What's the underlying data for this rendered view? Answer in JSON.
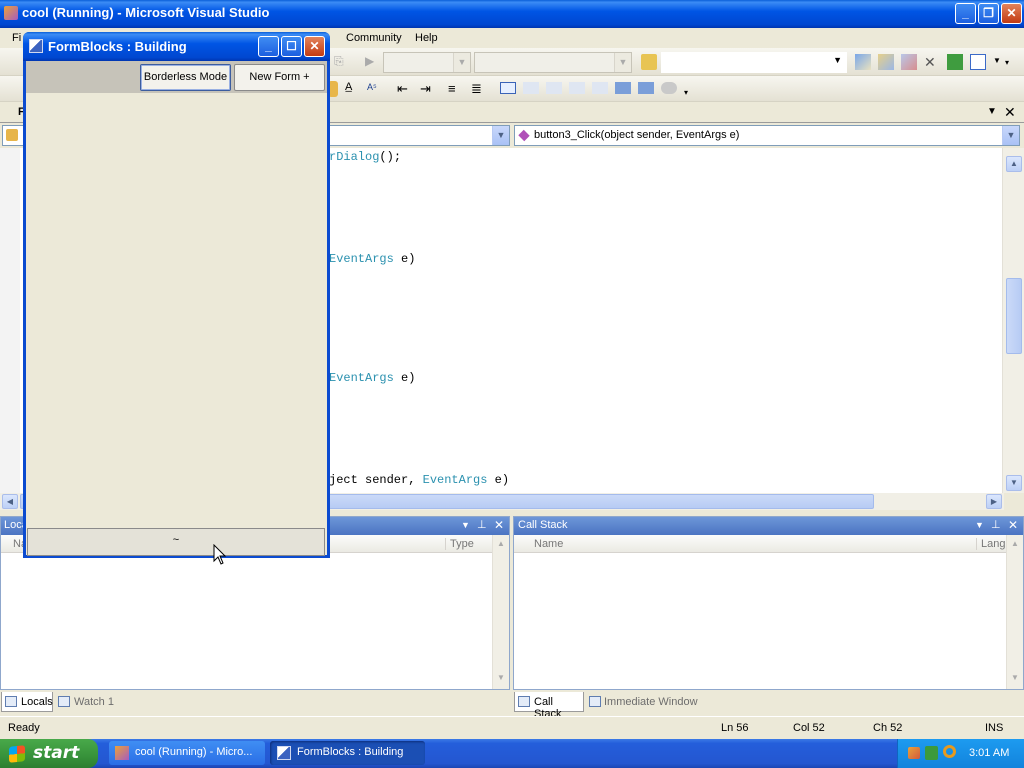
{
  "vs": {
    "title": "cool (Running) - Microsoft Visual Studio",
    "menu": [
      "Fi",
      "Community",
      "Help"
    ],
    "doc_tab_partial": "F",
    "member_combo": "button3_Click(object sender, EventArgs e)",
    "code_lines": [
      {
        "pre": "",
        "kw": "rDialog",
        "post": "();"
      },
      {
        "pre": "",
        "kw": "EventArgs",
        "post": " e)"
      },
      {
        "pre": "",
        "kw": "EventArgs",
        "post": " e)"
      },
      {
        "pre": "ject sender, ",
        "kw": "EventArgs",
        "post": " e)"
      }
    ]
  },
  "locals_panel": {
    "title": "Loca",
    "col_name": "Na",
    "col_type": "Type",
    "tabs": [
      "Locals",
      "Watch 1"
    ]
  },
  "callstack_panel": {
    "title": "Call Stack",
    "col_name": "Name",
    "col_lang": "Langu",
    "tabs": [
      "Call Stack",
      "Immediate Window"
    ]
  },
  "status": {
    "ready": "Ready",
    "ln": "Ln 56",
    "col": "Col 52",
    "ch": "Ch 52",
    "ins": "INS"
  },
  "formblocks": {
    "title": "FormBlocks : Building",
    "borderless_btn": "Borderless Mode",
    "newform_btn": "New Form +",
    "bottom_btn": "~"
  },
  "taskbar": {
    "start": "start",
    "tasks": [
      "cool (Running) - Micro...",
      "FormBlocks : Building"
    ],
    "clock": "3:01 AM"
  },
  "colors": {
    "xp_blue": "#0055e5",
    "start_green": "#3c9a3c",
    "code_keyword": "#2b91af"
  }
}
